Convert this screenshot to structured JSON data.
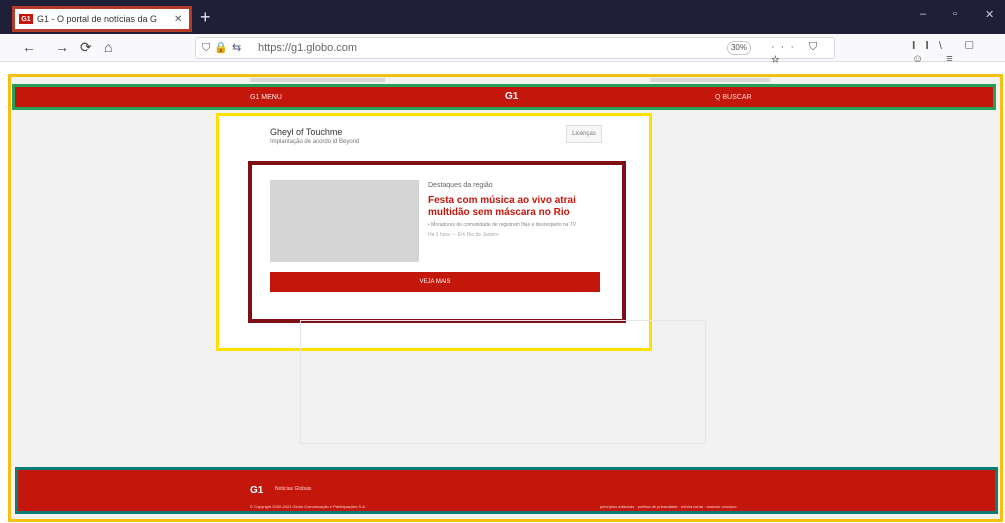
{
  "browser": {
    "tab_title": "G1 - O portal de notícias da G",
    "tab_favicon": "G1",
    "close_glyph": "✕",
    "new_tab_glyph": "+",
    "url": "https://g1.globo.com",
    "zoom": "30%",
    "window_controls": {
      "min": "–",
      "max": "▫",
      "close": "✕"
    },
    "nav_icons": [
      "←",
      "→",
      "⟳",
      "⌂"
    ],
    "url_icons": "⛉🔒⇆",
    "url_actions": "··· ⛉ ☆",
    "tools": "𝐈𝐈\\ ▢ ☺ ≡"
  },
  "site": {
    "menu_label": "G1 MENU",
    "logo": "G1",
    "search_label": "Q BUSCAR",
    "brand_color": "#c4170c"
  },
  "panel": {
    "name": "Gheyl of Touchme",
    "desc": "Implantação de acordo id Beyond",
    "button": "Licenças"
  },
  "card": {
    "kicker": "Destaques da região",
    "headline": "Festa com música ao vivo atrai multidão sem máscara no Rio",
    "related": "• Moradores de comunidade de registram filas e desrespeito na TV",
    "meta": "Há 1 hora — Em Rio de Janeiro",
    "cta": "VEJA MAIS"
  },
  "footer": {
    "logo": "G1",
    "tagline": "Notícias Globais",
    "copyright": "© Copyright 2000-2021 Globo Comunicação e Participações S.A.",
    "links": "princípios editoriais · política de privacidade · minha conta · anuncie conosco"
  }
}
